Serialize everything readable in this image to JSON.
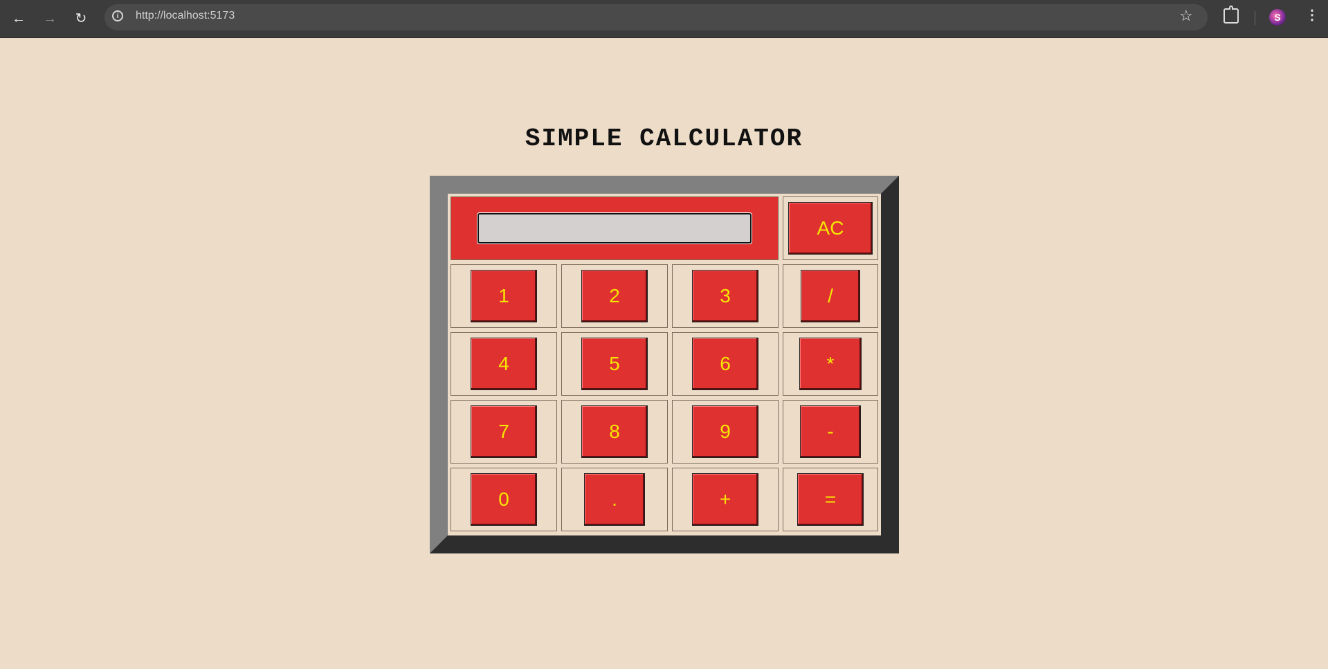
{
  "browser": {
    "url": "http://localhost:5173"
  },
  "page": {
    "title": "SIMPLE CALCULATOR"
  },
  "calculator": {
    "display_value": "",
    "keys": {
      "clear": "AC",
      "k1": "1",
      "k2": "2",
      "k3": "3",
      "divide": "/",
      "k4": "4",
      "k5": "5",
      "k6": "6",
      "multiply": "*",
      "k7": "7",
      "k8": "8",
      "k9": "9",
      "subtract": "-",
      "k0": "0",
      "decimal": ".",
      "add": "+",
      "equals": "="
    }
  },
  "colors": {
    "background": "#ecdcc8",
    "key_bg": "#e03131",
    "key_text": "#f5e600",
    "display_bg": "#d4d0cf"
  }
}
